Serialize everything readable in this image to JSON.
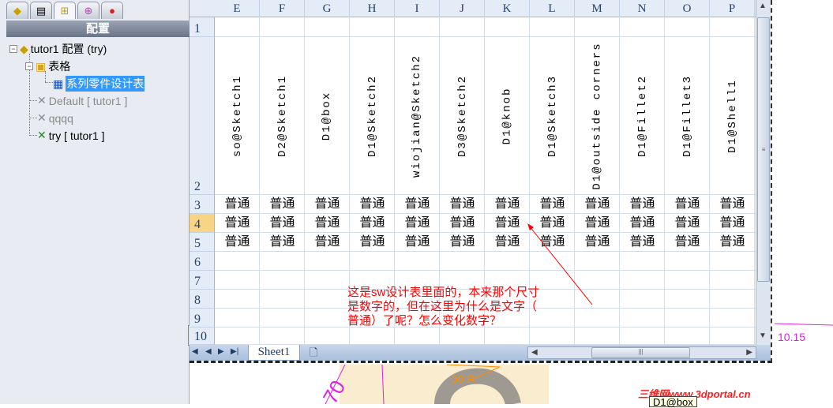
{
  "panel": {
    "title": "配置",
    "tabs": [
      "feature-manager",
      "property-manager",
      "configuration-manager",
      "dimxpert-manager",
      "display-manager"
    ]
  },
  "tree": {
    "root": "tutor1 配置 (try)",
    "tables": "表格",
    "design_table": "系列零件设计表",
    "configs": [
      "Default [ tutor1 ]",
      "qqqq",
      "try [ tutor1 ]"
    ]
  },
  "sheet": {
    "columns": [
      "E",
      "F",
      "G",
      "H",
      "I",
      "J",
      "K",
      "L",
      "M",
      "N",
      "O",
      "P"
    ],
    "rows": [
      "1",
      "2",
      "3",
      "4",
      "5",
      "6",
      "7",
      "8",
      "9",
      "10"
    ],
    "headers": [
      "so@Sketch1",
      "D2@Sketch1",
      "D1@box",
      "D1@Sketch2",
      "wiojian@Sketch2",
      "D3@Sketch2",
      "D1@knob",
      "D1@Sketch3",
      "D1@outside corners",
      "D1@Fillet2",
      "D1@Fillet3",
      "D1@Shell1"
    ],
    "cell_value": "普通",
    "active_row": "4",
    "tab": "Sheet1"
  },
  "annotation": [
    "这是sw设计表里面的，本来那个尺寸",
    "是数字的，但在这里为什么是文字（",
    "普通）了呢？怎么变化数字？"
  ],
  "watermark": "三维网www.3dportal.cn",
  "tooltip": "D1@box",
  "colors": {
    "annotation": "#ff0000",
    "selection": "#3399ff",
    "active_row": "#f8d486"
  }
}
